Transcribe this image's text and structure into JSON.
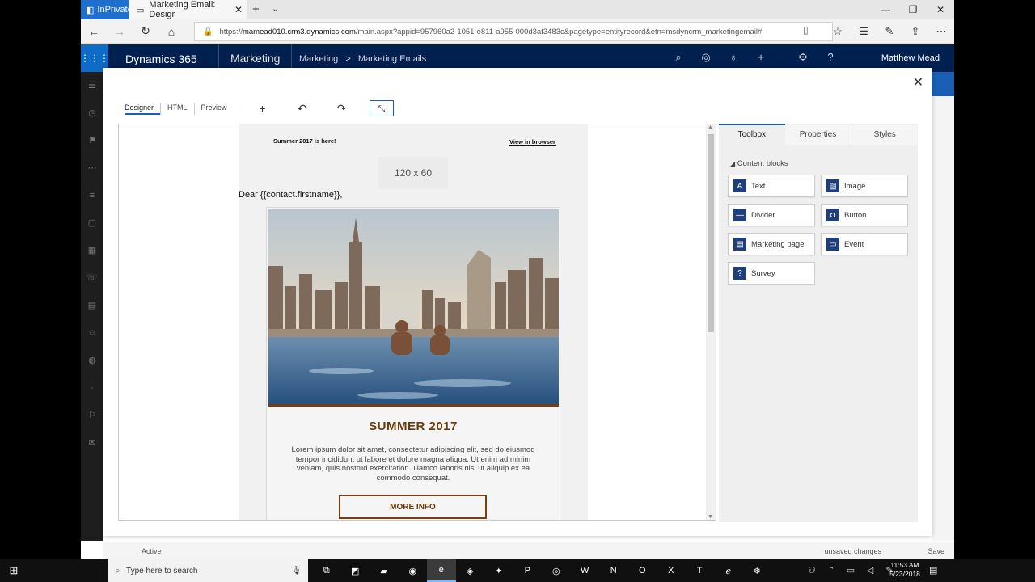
{
  "browser": {
    "inprivate_label": "InPrivate",
    "tab_title": "Marketing Email: Desigr",
    "url_prefix": "https://",
    "url_host": "mamead010.crm3.dynamics.com",
    "url_path": "/main.aspx?appid=957960a2-1051-e811-a955-000d3af3483c&pagetype=entityrecord&etn=msdyncrm_marketingemail#"
  },
  "d365": {
    "brand": "Dynamics 365",
    "app": "Marketing",
    "breadcrumb_1": "Marketing",
    "breadcrumb_sep": ">",
    "breadcrumb_2": "Marketing Emails",
    "user": "Matthew Mead"
  },
  "editor": {
    "tabs": [
      "Designer",
      "HTML",
      "Preview"
    ],
    "active_tab": "Designer"
  },
  "email": {
    "teaser": "Summer 2017 is here!",
    "view_in_browser": "View in browser",
    "logo_placeholder": "120 x 60",
    "greeting": "Dear {{contact.firstname}},",
    "headline": "SUMMER 2017",
    "body": "Lorem ipsum dolor sit amet, consectetur adipiscing elit, sed do eiusmod tempor incididunt ut labore et dolore magna aliqua. Ut enim ad minim veniam, quis nostrud exercitation ullamco laboris nisi ut aliquip ex ea commodo consequat.",
    "cta": "MORE INFO"
  },
  "panel": {
    "tabs": [
      "Toolbox",
      "Properties",
      "Styles"
    ],
    "active_tab": "Toolbox",
    "section": "Content blocks",
    "blocks": [
      {
        "label": "Text",
        "icon": "text-icon"
      },
      {
        "label": "Image",
        "icon": "image-icon"
      },
      {
        "label": "Divider",
        "icon": "divider-icon"
      },
      {
        "label": "Button",
        "icon": "button-icon"
      },
      {
        "label": "Marketing page",
        "icon": "marketing-page-icon"
      },
      {
        "label": "Event",
        "icon": "event-icon"
      },
      {
        "label": "Survey",
        "icon": "survey-icon"
      }
    ]
  },
  "status": {
    "state": "Active",
    "unsaved": "unsaved changes",
    "save": "Save"
  },
  "taskbar": {
    "search_placeholder": "Type here to search",
    "time": "11:53 AM",
    "date": "5/23/2018"
  },
  "colors": {
    "accent": "#1a5fb4",
    "header": "#002050",
    "brand_brown": "#6b3908"
  }
}
